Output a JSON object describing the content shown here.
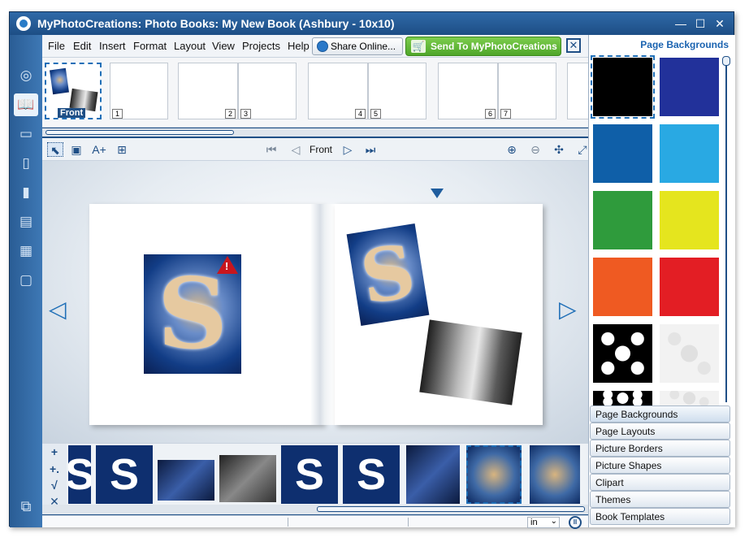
{
  "window": {
    "title": "MyPhotoCreations: Photo Books: My New Book (Ashbury - 10x10)",
    "minimize": "—",
    "maximize": "☐",
    "close": "✕"
  },
  "menu": {
    "items": [
      "File",
      "Edit",
      "Insert",
      "Format",
      "Layout",
      "View",
      "Projects",
      "Help"
    ],
    "share_label": "Share Online...",
    "send_label": "Send To MyPhotoCreations",
    "cart_icon": "🛒",
    "close_panel": "✕"
  },
  "filmstrip": {
    "front_label": "Front",
    "page_numbers": [
      "1",
      "2",
      "3",
      "4",
      "5",
      "6",
      "7"
    ]
  },
  "toolbar": {
    "page_label": "Front",
    "tools": {
      "select": "⬉",
      "add_photo": "▣",
      "add_text": "A+",
      "add_frame": "⊞",
      "first": "⏮",
      "prev": "◁",
      "next": "▷",
      "last": "⏭",
      "zoom_in": "⊕",
      "zoom_out": "⊖",
      "fit": "✣",
      "expand": "⤢"
    }
  },
  "canvas": {
    "prev_arrow": "◁",
    "next_arrow": "▷",
    "photo_letter": "S"
  },
  "bottom_tools": {
    "add": "+",
    "add_multi": "+.",
    "check": "√",
    "remove": "✕"
  },
  "tray": {
    "letter": "S"
  },
  "status": {
    "unit": "in",
    "unit_chevron": "⌄",
    "pause_icon": "II"
  },
  "right_panel": {
    "title": "Page Backgrounds",
    "swatches": [
      "#000000",
      "#22319a",
      "#0f5fa8",
      "#29a9e3",
      "#2f9b3c",
      "#e5e51e",
      "#ef5a22",
      "#e31e24"
    ],
    "tabs": [
      "Page Backgrounds",
      "Page Layouts",
      "Picture Borders",
      "Picture Shapes",
      "Clipart",
      "Themes",
      "Book Templates"
    ]
  },
  "left_bar": {
    "icons": [
      "◎",
      "📖",
      "▭",
      "▯",
      "▮",
      "▤",
      "▦",
      "▢"
    ],
    "bottom_icon": "⧉"
  }
}
